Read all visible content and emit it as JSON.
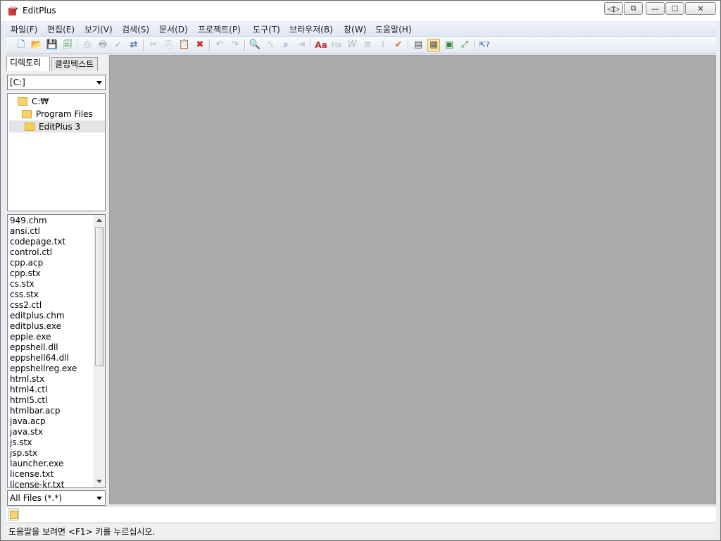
{
  "window": {
    "title": "EditPlus"
  },
  "caption_buttons": [
    "◁▷",
    "⧉",
    "—",
    "☐",
    "✕"
  ],
  "menu": [
    {
      "label": "파일(F)"
    },
    {
      "label": "편집(E)"
    },
    {
      "label": "보기(V)"
    },
    {
      "label": "검색(S)"
    },
    {
      "label": "문서(D)"
    },
    {
      "label": "프로젝트(P)"
    },
    {
      "label": "도구(T)"
    },
    {
      "label": "브라우저(B)"
    },
    {
      "label": "창(W)"
    },
    {
      "label": "도움말(H)"
    }
  ],
  "toolbar": {
    "icons": [
      {
        "name": "new-file-icon",
        "glyph": "🗋"
      },
      {
        "name": "open-folder-icon",
        "glyph": "📂"
      },
      {
        "name": "save-icon",
        "glyph": "💾"
      },
      {
        "name": "save-all-icon",
        "glyph": "🗐"
      },
      {
        "name": "print-preview-icon",
        "glyph": "⎙"
      },
      {
        "name": "print-icon",
        "glyph": "🖶"
      },
      {
        "name": "spellcheck-icon",
        "glyph": "✓"
      },
      {
        "name": "browser-preview-icon",
        "glyph": "⇄"
      },
      {
        "name": "cut-icon",
        "glyph": "✂"
      },
      {
        "name": "copy-icon",
        "glyph": "⎘"
      },
      {
        "name": "paste-icon",
        "glyph": "📋"
      },
      {
        "name": "delete-icon",
        "glyph": "✖"
      },
      {
        "name": "undo-icon",
        "glyph": "↶"
      },
      {
        "name": "redo-icon",
        "glyph": "↷"
      },
      {
        "name": "find-icon",
        "glyph": "🔍"
      },
      {
        "name": "replace-icon",
        "glyph": "ᴬᵦ"
      },
      {
        "name": "find-in-files-icon",
        "glyph": "⌕"
      },
      {
        "name": "goto-line-icon",
        "glyph": "⇥"
      },
      {
        "name": "font-icon",
        "glyph": "Aa"
      },
      {
        "name": "hex-icon",
        "glyph": "Hx"
      },
      {
        "name": "word-wrap-icon",
        "glyph": "W"
      },
      {
        "name": "line-number-icon",
        "glyph": "≡"
      },
      {
        "name": "ruler-icon",
        "glyph": "⁞"
      },
      {
        "name": "check-icon",
        "glyph": "✔"
      },
      {
        "name": "output-window-icon",
        "glyph": "▤"
      },
      {
        "name": "directory-window-icon",
        "glyph": "▦"
      },
      {
        "name": "cliptext-icon",
        "glyph": "▣"
      },
      {
        "name": "full-screen-icon",
        "glyph": "⤢"
      },
      {
        "name": "help-pointer-icon",
        "glyph": "⇱?"
      }
    ]
  },
  "left_pane": {
    "tabs": [
      {
        "label": "디렉토리"
      },
      {
        "label": "클립텍스트"
      }
    ],
    "drive": "[C:]",
    "tree": [
      {
        "label": "C:₩"
      },
      {
        "label": "Program Files"
      },
      {
        "label": "EditPlus 3"
      }
    ],
    "files": [
      "949.chm",
      "ansi.ctl",
      "codepage.txt",
      "control.ctl",
      "cpp.acp",
      "cpp.stx",
      "cs.stx",
      "css.stx",
      "css2.ctl",
      "editplus.chm",
      "editplus.exe",
      "eppie.exe",
      "eppshell.dll",
      "eppshell64.dll",
      "eppshellreg.exe",
      "html.stx",
      "html4.ctl",
      "html5.ctl",
      "htmlbar.acp",
      "java.acp",
      "java.stx",
      "js.stx",
      "jsp.stx",
      "launcher.exe",
      "license.txt",
      "license-kr.txt"
    ],
    "filter": "All Files (*.*)"
  },
  "status": {
    "text": "도움말을 보려면 <F1> 키를 누르십시오."
  },
  "colors": {
    "editor_bg": "#ababab",
    "menu_bg": "#e4eaf5"
  }
}
